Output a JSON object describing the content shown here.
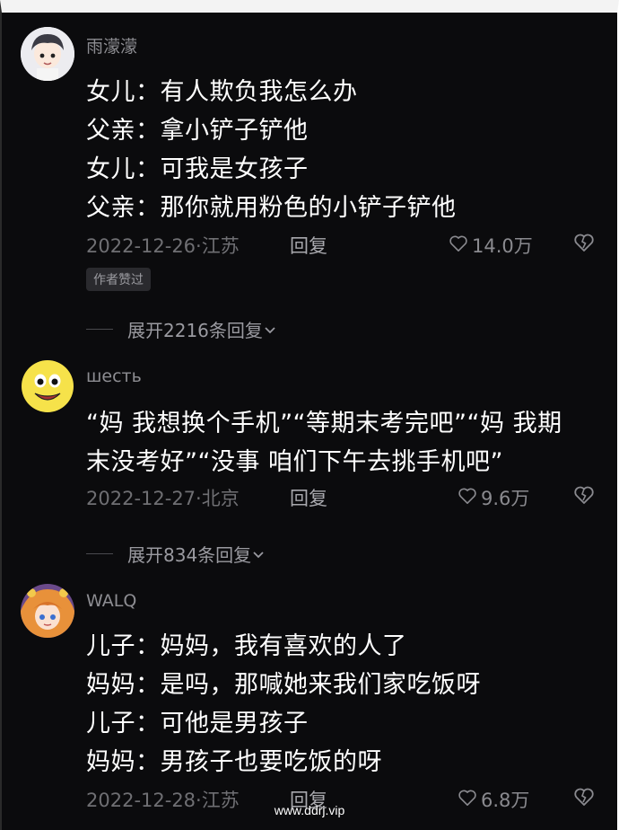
{
  "comments": [
    {
      "username": "雨濛濛",
      "lines": [
        "女儿：有人欺负我怎么办",
        "父亲：拿小铲子铲他",
        "女儿：可我是女孩子",
        "父亲：那你就用粉色的小铲子铲他"
      ],
      "date_location": "2022-12-26·江苏",
      "reply_label": "回复",
      "likes": "14.0万",
      "badge": "作者赞过",
      "expand_label": "展开2216条回复"
    },
    {
      "username": "шесть",
      "lines": [
        "“妈 我想换个手机”“等期末考完吧”“妈 我期",
        "末没考好”“没事 咱们下午去挑手机吧”"
      ],
      "date_location": "2022-12-27·北京",
      "reply_label": "回复",
      "likes": "9.6万",
      "expand_label": "展开834条回复"
    },
    {
      "username": "WALQ",
      "lines": [
        "儿子：妈妈，我有喜欢的人了",
        "妈妈：是吗，那喊她来我们家吃饭呀",
        "儿子：可他是男孩子",
        "妈妈：男孩子也要吃饭的呀"
      ],
      "date_location": "2022-12-28·江苏",
      "reply_label": "回复",
      "likes": "6.8万"
    }
  ],
  "watermark": "www.ddrj.vip",
  "icons": {
    "like": "heart-outline-icon",
    "dislike": "broken-heart-icon",
    "expand": "chevron-down-icon"
  }
}
